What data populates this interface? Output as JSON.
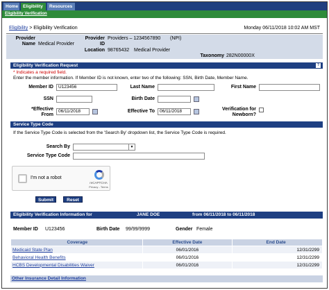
{
  "nav": {
    "tabs": [
      "Home",
      "Eligibility",
      "Resources"
    ],
    "sub_item": "Eligibility Verification"
  },
  "breadcrumb": {
    "root": "Eligibility",
    "sep": ">",
    "current": "Eligibility Verification"
  },
  "datetime": "Monday 06/11/2018 10:02 AM MST",
  "provider": {
    "name_label_1": "Provider",
    "name_label_2": "Name",
    "name_value": "Medical Provider",
    "id_label_1": "Provider",
    "id_label_2": "ID",
    "id_value": "Providers – 1234567890",
    "id_type": "(NPI)",
    "location_label": "Location",
    "location_code": "98765432",
    "location_name": "Medical Provider",
    "taxonomy_label": "Taxonomy",
    "taxonomy_value": "282N00000X"
  },
  "request_section": {
    "title": "Eligibility Verification Request",
    "help_icon": "?",
    "required_note": "* Indicates a required field.",
    "instructions": "Enter the member information. If Member ID is not known, enter two of the following: SSN, Birth Date, Member Name.",
    "member_id_label": "Member ID",
    "member_id_value": "U123456",
    "last_name_label": "Last Name",
    "first_name_label": "First Name",
    "ssn_label": "SSN",
    "birth_date_label": "Birth Date",
    "eff_from_label_1": "*Effective",
    "eff_from_label_2": "From",
    "eff_from_value": "06/11/2018",
    "eff_to_label": "Effective To",
    "eff_to_value": "06/11/2018",
    "newborn_label_1": "Verification for",
    "newborn_label_2": "Newborn?"
  },
  "service_section": {
    "title": "Service Type Code",
    "instructions": "If the Service Type Code is selected from the 'Search By' dropdown list, the Service Type Code is required.",
    "search_by_label": "Search By",
    "service_code_label": "Service Type Code"
  },
  "captcha": {
    "label": "I'm not a robot",
    "brand": "reCAPTCHA",
    "links": "Privacy - Terms"
  },
  "buttons": {
    "submit": "Submit",
    "reset": "Reset"
  },
  "results": {
    "header_label": "Eligibility Verification Information for",
    "member_name": "JANE DOE",
    "range_label": "from 06/11/2018 to 06/11/2018",
    "member_id_label": "Member ID",
    "member_id_value": "U123456",
    "birth_date_label": "Birth Date",
    "birth_date_value": "99/99/9999",
    "gender_label": "Gender",
    "gender_value": "Female",
    "columns": [
      "Coverage",
      "Effective Date",
      "End Date"
    ],
    "rows": [
      {
        "coverage": "Medicaid State Plan",
        "effective": "06/01/2016",
        "end": "12/31/2299"
      },
      {
        "coverage": "Behavioral Health Benefits",
        "effective": "06/01/2016",
        "end": "12/31/2299"
      },
      {
        "coverage": "HCBS Developmental Disabilities Waiver",
        "effective": "06/01/2016",
        "end": "12/31/2299"
      }
    ],
    "other_insurance": "Other Insurance Detail Information"
  }
}
